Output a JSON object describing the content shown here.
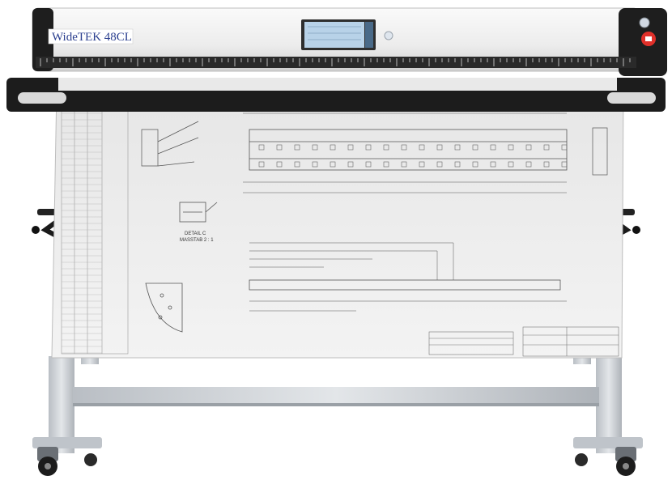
{
  "scanner": {
    "brand_label": "WideTEK 48CL",
    "brand_color": "#2b3f8f",
    "body_color": "#f2f2f2",
    "end_cap_color": "#1e1e1e",
    "stop_button_color": "#e0302a",
    "screen_color": "#b8d2e8"
  },
  "drawing": {
    "detail_label_line1": "DETAIL C",
    "detail_label_line2": "MASSTAB 2 : 1"
  },
  "stand": {
    "frame_color": "#c8cdd2"
  }
}
